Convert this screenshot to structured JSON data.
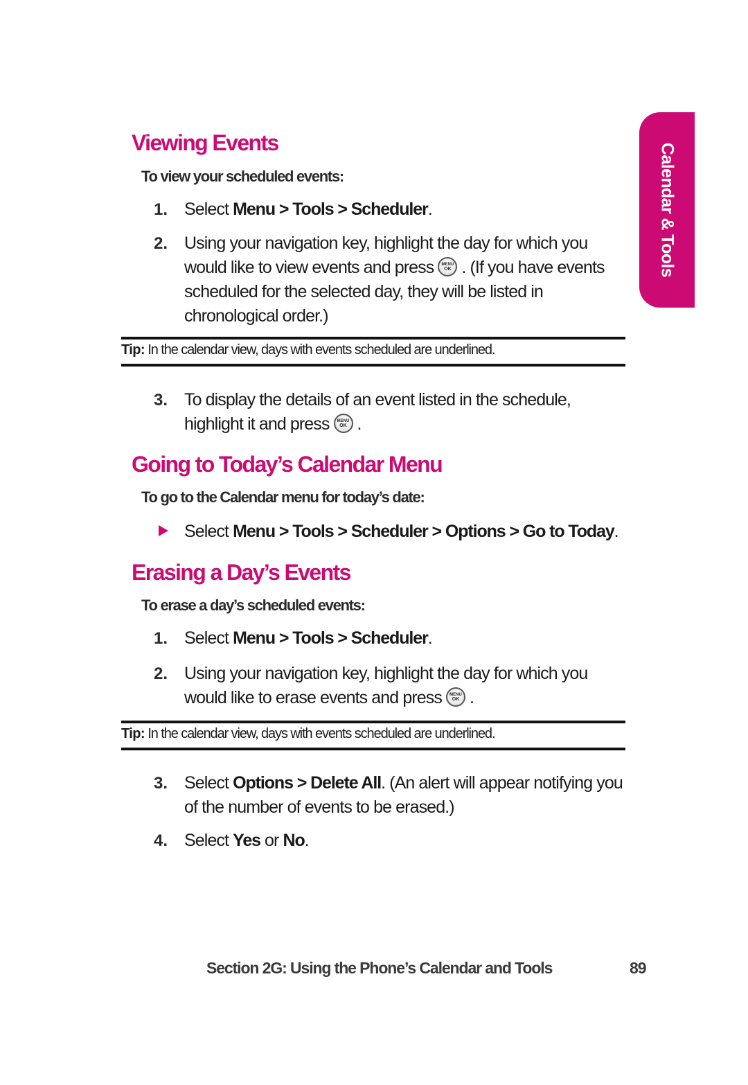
{
  "side_tab": {
    "label": "Calendar & Tools",
    "color": "#cc0a74"
  },
  "sections": {
    "viewing": {
      "title": "Viewing Events",
      "intro": "To view your scheduled events:",
      "steps": [
        {
          "num": "1.",
          "pre": "Select ",
          "path": "Menu > Tools > Scheduler",
          "post": "."
        },
        {
          "num": "2.",
          "pre": "Using your navigation key, highlight the day for which you would like to view events and press",
          "post": ". (If you have events scheduled for the selected day, they will be listed in chronological order.)"
        },
        {
          "num": "3.",
          "pre": "To display the details of an event listed in the schedule, highlight it and press",
          "post": "."
        }
      ],
      "tip": {
        "label": "Tip:",
        "text": " In the calendar view, days with events scheduled are underlined."
      }
    },
    "today": {
      "title": "Going to Today’s Calendar Menu",
      "intro": "To go to the Calendar menu for today’s date:",
      "step": {
        "pre": "Select ",
        "path": "Menu > Tools > Scheduler > Options > Go to Today",
        "post": "."
      }
    },
    "erasing": {
      "title": "Erasing a Day’s Events",
      "intro": "To erase a day’s scheduled events:",
      "steps": [
        {
          "num": "1.",
          "pre": "Select ",
          "path": "Menu > Tools > Scheduler",
          "post": "."
        },
        {
          "num": "2.",
          "pre": "Using your navigation key, highlight the day for which you would like to erase events and press",
          "post": "."
        },
        {
          "num": "3.",
          "pre": "Select ",
          "path": "Options > Delete All",
          "post": ". (An alert will appear notifying you of the number of events to be erased.)"
        },
        {
          "num": "4.",
          "pre": "Select ",
          "yes": "Yes",
          "or": " or ",
          "no": "No",
          "post": "."
        }
      ],
      "tip": {
        "label": "Tip:",
        "text": " In the calendar view, days with events scheduled are underlined."
      }
    }
  },
  "icons": {
    "menu_ok": {
      "top": "MENU",
      "bottom": "OK"
    }
  },
  "footer": {
    "section": "Section 2G: Using the Phone’s Calendar and Tools",
    "page": "89"
  }
}
